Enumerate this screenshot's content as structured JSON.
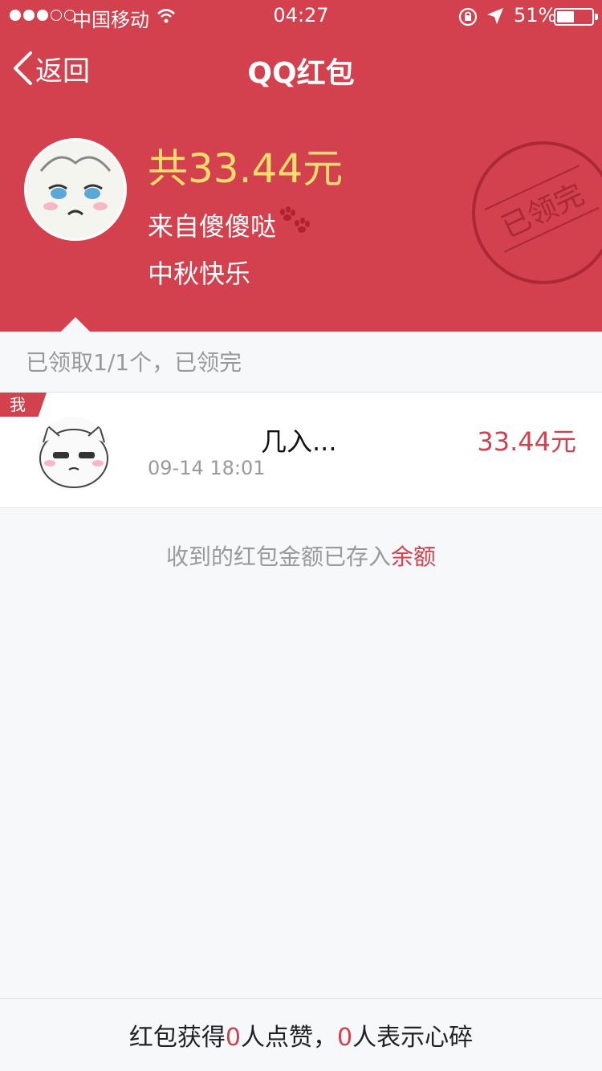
{
  "status_bar": {
    "carrier": "中国移动",
    "time": "04:27",
    "battery": "51%",
    "battery_level": 0.51
  },
  "nav": {
    "back_label": "返回",
    "title": "QQ红包"
  },
  "packet": {
    "total": "共33.44元",
    "sender": "来自傻傻哒",
    "blessing": "中秋快乐",
    "stamp": "已领完"
  },
  "summary": "已领取1/1个，已领完",
  "receiver": {
    "badge": "我",
    "name": "几入...",
    "time": "09-14 18:01",
    "amount": "33.44元"
  },
  "note": {
    "text": "收到的红包金额已存入",
    "link": "余额"
  },
  "footer": {
    "prefix": "红包获得",
    "likes": "0",
    "middle": "人点赞，",
    "hearts": "0",
    "suffix": "人表示心碎"
  },
  "colors": {
    "header_red": "#d2414d",
    "amount_gold": "#fbdc6e",
    "background": "#f7f8fa"
  }
}
